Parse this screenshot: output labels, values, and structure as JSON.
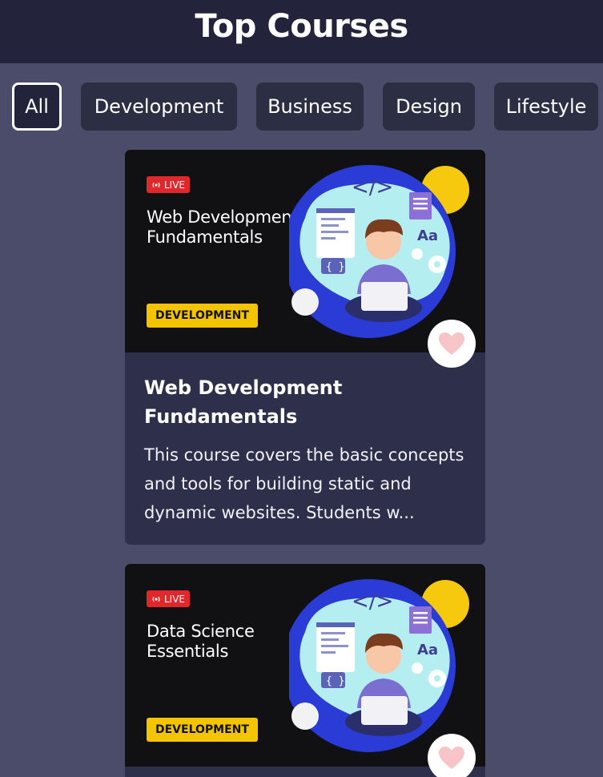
{
  "header": {
    "title": "Top Courses"
  },
  "filters": [
    {
      "label": "All",
      "active": true
    },
    {
      "label": "Development",
      "active": false
    },
    {
      "label": "Business",
      "active": false
    },
    {
      "label": "Design",
      "active": false
    },
    {
      "label": "Lifestyle",
      "active": false
    }
  ],
  "courses": [
    {
      "live_label": "LIVE",
      "banner_title": "Web Development Fundamentals",
      "tag": "DEVELOPMENT",
      "title": "Web Development Fundamentals",
      "description": "This course covers the basic concepts and tools for building static and dynamic websites. Students w..."
    },
    {
      "live_label": "LIVE",
      "banner_title": "Data Science Essentials",
      "tag": "DEVELOPMENT"
    }
  ],
  "colors": {
    "header_bg": "#23233b",
    "page_bg": "#4a4c6a",
    "chip_bg": "#2c2e44",
    "card_bg": "#2e2f4b",
    "live_red": "#e0272c",
    "tag_yellow": "#f4c400",
    "heart_pink": "#f7c4c8"
  },
  "icons": [
    "live-broadcast-icon",
    "heart-icon",
    "code-icon",
    "document-icon",
    "gear-icon"
  ]
}
